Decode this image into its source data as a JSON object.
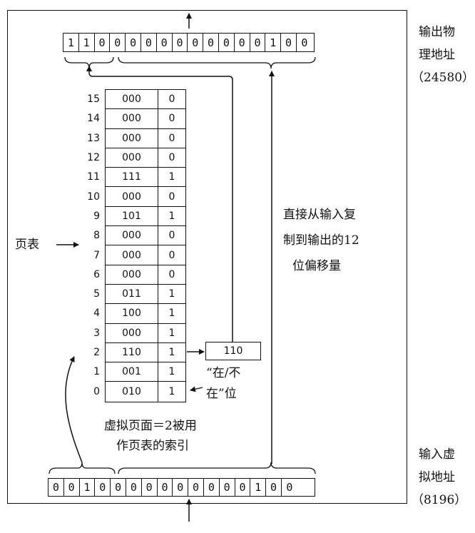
{
  "output": {
    "bits": [
      "1",
      "1",
      "0",
      "0",
      "0",
      "0",
      "0",
      "0",
      "0",
      "0",
      "0",
      "0",
      "0",
      "1",
      "0",
      "0"
    ],
    "label": [
      "输出物",
      "理地址",
      "（24580）"
    ]
  },
  "input": {
    "bits": [
      "0",
      "0",
      "1",
      "0",
      "0",
      "0",
      "0",
      "0",
      "0",
      "0",
      "0",
      "0",
      "0",
      "1",
      "0",
      "0"
    ],
    "label": [
      "输入虚",
      "拟地址",
      "（8196）"
    ]
  },
  "page_table": {
    "label": "页表",
    "rows": [
      {
        "index": "15",
        "frame": "000",
        "present": "0"
      },
      {
        "index": "14",
        "frame": "000",
        "present": "0"
      },
      {
        "index": "13",
        "frame": "000",
        "present": "0"
      },
      {
        "index": "12",
        "frame": "000",
        "present": "0"
      },
      {
        "index": "11",
        "frame": "111",
        "present": "1"
      },
      {
        "index": "10",
        "frame": "000",
        "present": "0"
      },
      {
        "index": "9",
        "frame": "101",
        "present": "1"
      },
      {
        "index": "8",
        "frame": "000",
        "present": "0"
      },
      {
        "index": "7",
        "frame": "000",
        "present": "0"
      },
      {
        "index": "6",
        "frame": "000",
        "present": "0"
      },
      {
        "index": "5",
        "frame": "011",
        "present": "1"
      },
      {
        "index": "4",
        "frame": "100",
        "present": "1"
      },
      {
        "index": "3",
        "frame": "000",
        "present": "1"
      },
      {
        "index": "2",
        "frame": "110",
        "present": "1"
      },
      {
        "index": "1",
        "frame": "001",
        "present": "1"
      },
      {
        "index": "0",
        "frame": "010",
        "present": "1"
      }
    ]
  },
  "selected_frame": "110",
  "offset_note": [
    "直接从输入复",
    "制到输出的12",
    "位偏移量"
  ],
  "present_bit_note": [
    "“在/不",
    "在”位"
  ],
  "index_note": [
    "虚拟页面＝2被用",
    "作页表的索引"
  ]
}
